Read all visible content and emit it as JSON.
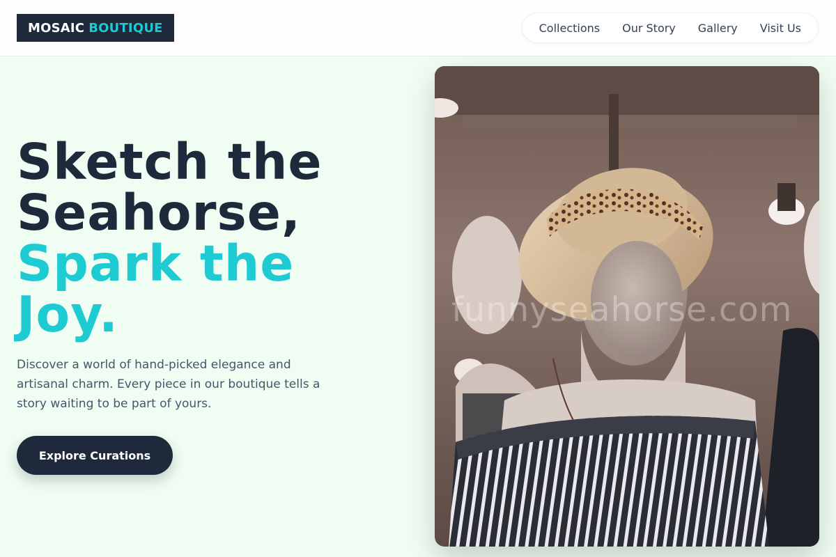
{
  "brand": {
    "name_primary": "MOSAIC",
    "name_accent": "BOUTIQUE"
  },
  "nav": {
    "items": [
      "Collections",
      "Our Story",
      "Gallery",
      "Visit Us"
    ]
  },
  "hero": {
    "title_line1": "Sketch the",
    "title_line2": "Seahorse,",
    "title_line3": "Spark the",
    "title_line4": "Joy.",
    "description": "Discover a world of hand-picked elegance and artisanal charm. Every piece in our boutique tells a story waiting to be part of yours.",
    "cta_label": "Explore Curations",
    "image_watermark": "funnyseahorse.com"
  },
  "colors": {
    "background": "#effdf2",
    "header": "#fdfefd",
    "dark": "#1e293b",
    "accent": "#1ecbd2",
    "muted_text": "#475569"
  }
}
